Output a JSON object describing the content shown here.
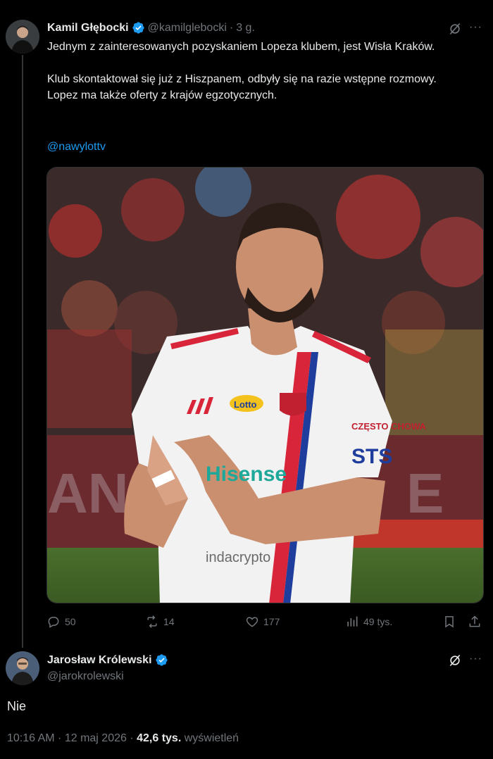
{
  "tweet": {
    "author_name": "Kamil Głębocki",
    "handle": "@kamilglebocki",
    "separator": "·",
    "time": "3 g.",
    "text_line1": "Jednym z zainteresowanych pozyskaniem Lopeza klubem, jest Wisła Kraków.",
    "text_line2": "Klub skontaktował się już z Hiszpanem, odbyły się na razie wstępne rozmowy. Lopez ma także oferty z krajów egzotycznych.",
    "mention": "@nawylottv",
    "more_label": "···",
    "photo": {
      "sponsor_main": "Hisense",
      "sponsor_bottom": "indacrypto",
      "sponsor_badge": "Lotto",
      "sleeve_sponsor_1": "CZĘSTO CHOWA",
      "sleeve_sponsor_2": "STS",
      "jersey_colors": {
        "shirt": "#f5f5f5",
        "red": "#d9253a",
        "blue": "#1f3d9c"
      }
    }
  },
  "actions": {
    "replies": "50",
    "reposts": "14",
    "likes": "177",
    "views": "49 tys."
  },
  "reply": {
    "author_name": "Jarosław Królewski",
    "handle": "@jarokrolewski",
    "text": "Nie",
    "more_label": "···",
    "timestamp": "10:16 AM · 12 maj 2026 · ",
    "views_count": "42,6 tys.",
    "views_label": "wyświetleń"
  },
  "colors": {
    "background": "#000000",
    "text": "#e7e9ea",
    "secondary": "#71767b",
    "accent": "#1d9bf0"
  }
}
